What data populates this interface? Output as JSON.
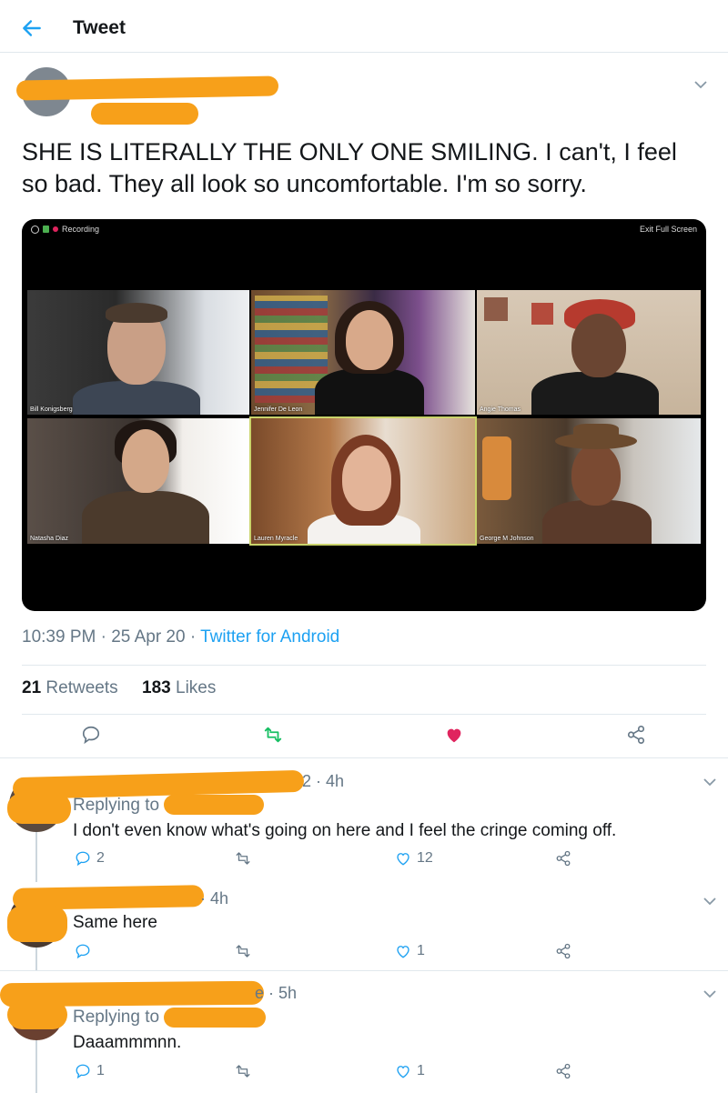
{
  "header": {
    "title": "Tweet"
  },
  "tweet": {
    "text": "SHE IS LITERALLY THE ONLY ONE SMILING. I can't, I feel so bad. They all look so uncomfortable. I'm so sorry.",
    "time": "10:39 PM",
    "date": "25 Apr 20",
    "source": "Twitter for Android",
    "retweets": "21",
    "retweets_label": "Retweets",
    "likes": "183",
    "likes_label": "Likes",
    "colors": {
      "accent": "#1da1f2",
      "liked": "#e0245e",
      "retweet": "#17bf63"
    }
  },
  "video": {
    "recording_label": "Recording",
    "exit_label": "Exit Full Screen",
    "participants": [
      "Bill Konigsberg",
      "Jennifer De Leon",
      "Angie Thomas",
      "Natasha Diaz",
      "Lauren Myracle",
      "George M Johnson"
    ]
  },
  "replies": [
    {
      "time": "2 · 4h",
      "replying_label": "Replying to",
      "text": "I don't even know what's going on here and I feel the cringe coming off.",
      "reply_count": "2",
      "like_count": "12"
    },
    {
      "time": "· 4h",
      "text": "Same here",
      "reply_count": "",
      "like_count": "1"
    },
    {
      "time": "e · 5h",
      "replying_label": "Replying to",
      "text": "Daaammmnn.",
      "reply_count": "1",
      "like_count": "1"
    }
  ],
  "icons": [
    "back-arrow-icon",
    "chevron-down-icon",
    "reply-icon",
    "retweet-icon",
    "heart-icon",
    "share-icon"
  ]
}
